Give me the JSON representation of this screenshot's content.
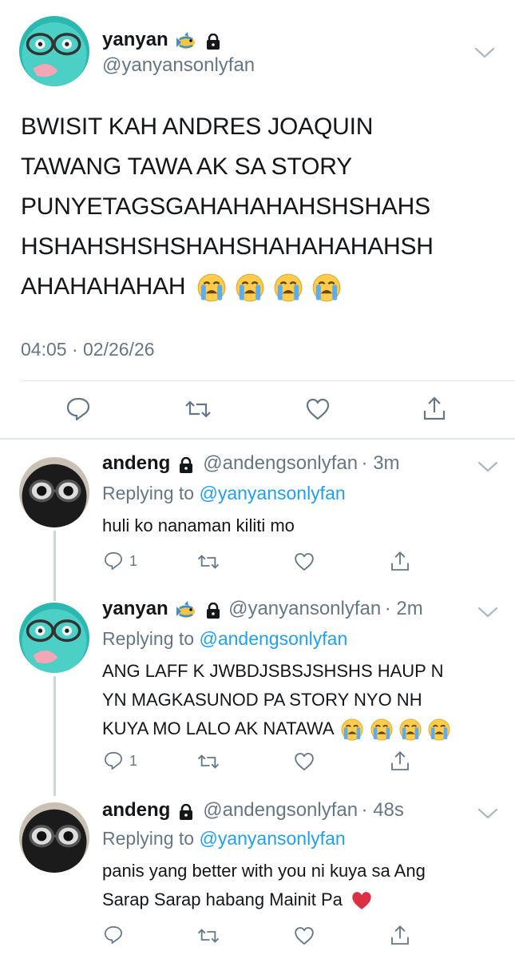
{
  "main_tweet": {
    "display_name": "yanyan",
    "handle": "@yanyansonlyfan",
    "text_lines": [
      "BWISIT KAH ANDRES JOAQUIN",
      "TAWANG TAWA AK SA STORY",
      "PUNYETAGSGAHAHAHAHSHSHAHS",
      "HSHAHSHSHSHAHSHAHAHAHAHSH",
      "AHAHAHAHAH"
    ],
    "timestamp": "04:05 · 02/26/26"
  },
  "replies": [
    {
      "display_name": "andeng",
      "handle": "@andengsonlyfan",
      "age": "· 3m",
      "replying_label": "Replying to",
      "replying_to": "@yanyansonlyfan",
      "text_lines": [
        "huli ko nanaman kiliti mo"
      ],
      "reply_count": "1"
    },
    {
      "display_name": "yanyan",
      "handle": "@yanyansonlyfan",
      "age": "· 2m",
      "replying_label": "Replying to",
      "replying_to": "@andengsonlyfan",
      "text_lines": [
        "ANG LAFF K JWBDJSBSJSHSHS HAUP N",
        "YN MAGKASUNOD PA STORY NYO NH",
        "KUYA MO LALO AK NATAWA"
      ],
      "reply_count": "1"
    },
    {
      "display_name": "andeng",
      "handle": "@andengsonlyfan",
      "age": "· 48s",
      "replying_label": "Replying to",
      "replying_to": "@yanyansonlyfan",
      "text_lines": [
        "panis yang better with you ni kuya sa Ang",
        "Sarap Sarap habang Mainit Pa"
      ],
      "reply_count": ""
    }
  ],
  "icons": {
    "reply": "reply-icon",
    "retweet": "retweet-icon",
    "like": "like-icon",
    "share": "share-icon",
    "lock": "lock-icon",
    "fish": "fish-emoji-icon",
    "crying": "loudly-crying-emoji-icon",
    "heart": "red-heart-emoji-icon",
    "chevron": "chevron-down-icon"
  },
  "colors": {
    "link": "#1da1f2",
    "secondary": "#657786",
    "divider": "#e1e8ed",
    "thread_line": "#ccd6dd"
  }
}
